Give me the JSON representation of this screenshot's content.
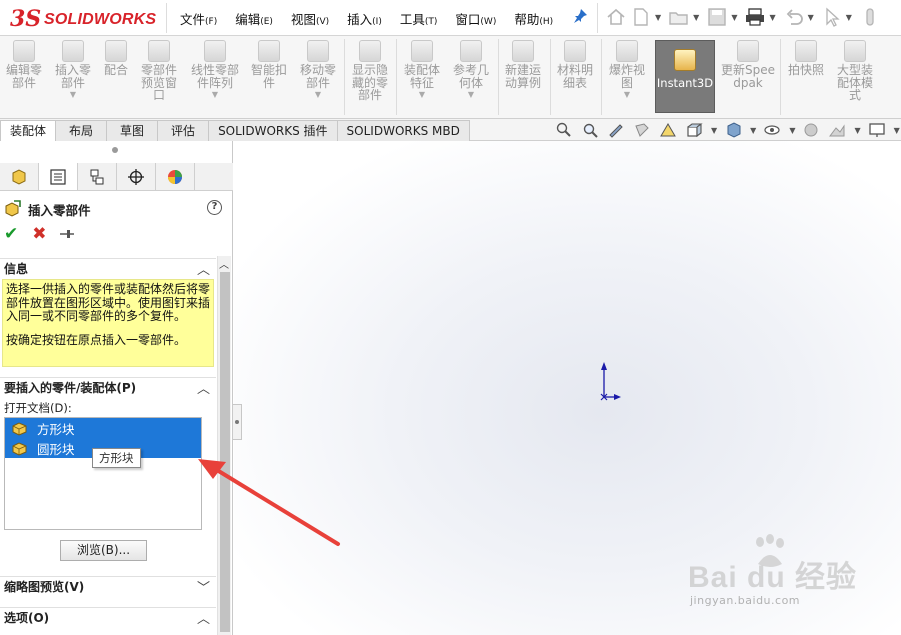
{
  "brand": {
    "ds": "3S",
    "name": "SOLIDWORKS",
    "color": "#d8232a"
  },
  "menu": [
    {
      "label": "文件",
      "key": "(F)"
    },
    {
      "label": "编辑",
      "key": "(E)"
    },
    {
      "label": "视图",
      "key": "(V)"
    },
    {
      "label": "插入",
      "key": "(I)"
    },
    {
      "label": "工具",
      "key": "(T)"
    },
    {
      "label": "窗口",
      "key": "(W)"
    },
    {
      "label": "帮助",
      "key": "(H)"
    }
  ],
  "toolbar": {
    "tools": [
      {
        "label": "编辑零部件"
      },
      {
        "label": "插入零部件"
      },
      {
        "label": "配合"
      },
      {
        "label": "零部件预览窗口"
      },
      {
        "label": "线性零部件阵列"
      },
      {
        "label": "智能扣件"
      },
      {
        "label": "移动零部件"
      },
      {
        "label": "显示隐藏的零部件"
      },
      {
        "label": "装配体特征"
      },
      {
        "label": "参考几何体"
      },
      {
        "label": "新建运动算例"
      },
      {
        "label": "材料明细表"
      },
      {
        "label": "爆炸视图"
      },
      {
        "label": "Instant3D"
      },
      {
        "label": "更新Speedpak"
      },
      {
        "label": "拍快照"
      },
      {
        "label": "大型装配体模式"
      }
    ]
  },
  "tabs": [
    "装配体",
    "布局",
    "草图",
    "评估",
    "SOLIDWORKS 插件",
    "SOLIDWORKS MBD"
  ],
  "property_manager": {
    "title": "插入零部件",
    "help": "?",
    "info_header": "信息",
    "info_text_1": "选择一供插入的零件或装配体然后将零部件放置在图形区域中。使用图钉来插入同一或不同零部件的多个复件。",
    "info_text_2": "按确定按钮在原点插入一零部件。",
    "parts_header": "要插入的零件/装配体(P)",
    "open_docs_label": "打开文档(D):",
    "open_docs": [
      "方形块",
      "圆形块"
    ],
    "tooltip": "方形块",
    "browse_label": "浏览(B)...",
    "thumb_header": "缩略图预览(V)",
    "options_header": "选项(O)"
  },
  "watermark": {
    "text": "Bai du 经验",
    "sub": "jingyan.baidu.com"
  },
  "colors": {
    "selection": "#1e78d8",
    "info_bg": "#ffff9a",
    "arrow": "#e8413a",
    "axis": "#1a1aa8"
  }
}
